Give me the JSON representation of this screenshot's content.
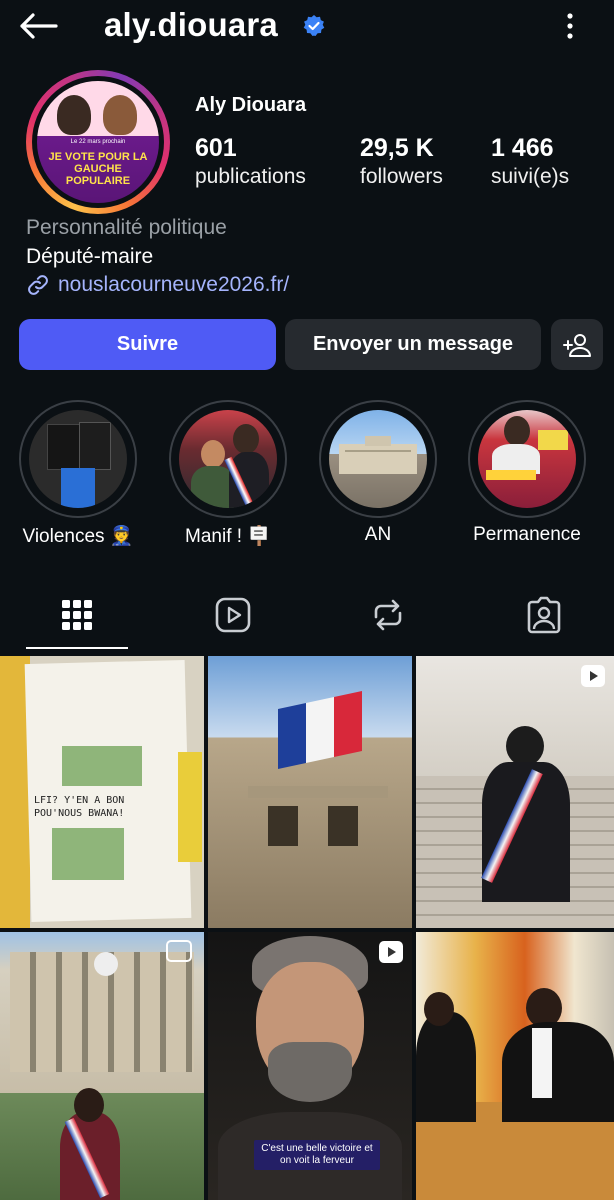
{
  "header": {
    "username": "aly.diouara",
    "verified": true,
    "back_icon": "arrow-left-icon",
    "more_icon": "more-vertical-icon"
  },
  "profile": {
    "full_name": "Aly Diouara",
    "avatar_text": {
      "top": "Le 22 mars prochain",
      "main": "JE VOTE POUR LA GAUCHE POPULAIRE"
    },
    "stats": [
      {
        "value": "601",
        "label": "publications"
      },
      {
        "value": "29,5 K",
        "label": "followers"
      },
      {
        "value": "1 466",
        "label": "suivi(e)s"
      }
    ],
    "category": "Personnalité politique",
    "bio": "Député-maire",
    "link": "nouslacourneuve2026.fr/"
  },
  "actions": {
    "follow": "Suivre",
    "message": "Envoyer un message",
    "add_user_icon": "add-person-icon"
  },
  "highlights": [
    {
      "label": "Violences 👮"
    },
    {
      "label": "Manif ! 🪧"
    },
    {
      "label": "AN"
    },
    {
      "label": "Permanence"
    }
  ],
  "tabs": [
    {
      "name": "grid",
      "icon": "grid-icon",
      "active": true
    },
    {
      "name": "reels",
      "icon": "reels-play-icon",
      "active": false
    },
    {
      "name": "reposts",
      "icon": "repost-icon",
      "active": false
    },
    {
      "name": "tagged",
      "icon": "tagged-person-icon",
      "active": false
    }
  ],
  "posts": {
    "p5_caption": "C'est une belle victoire et on voit la ferveur",
    "p1_text": "LFI? Y'EN A BON POU'NOUS BWANA!"
  },
  "colors": {
    "background": "#0b1014",
    "accent_button": "#4f5bf5",
    "link": "#a5b4fc",
    "verified": "#3b82f6"
  }
}
